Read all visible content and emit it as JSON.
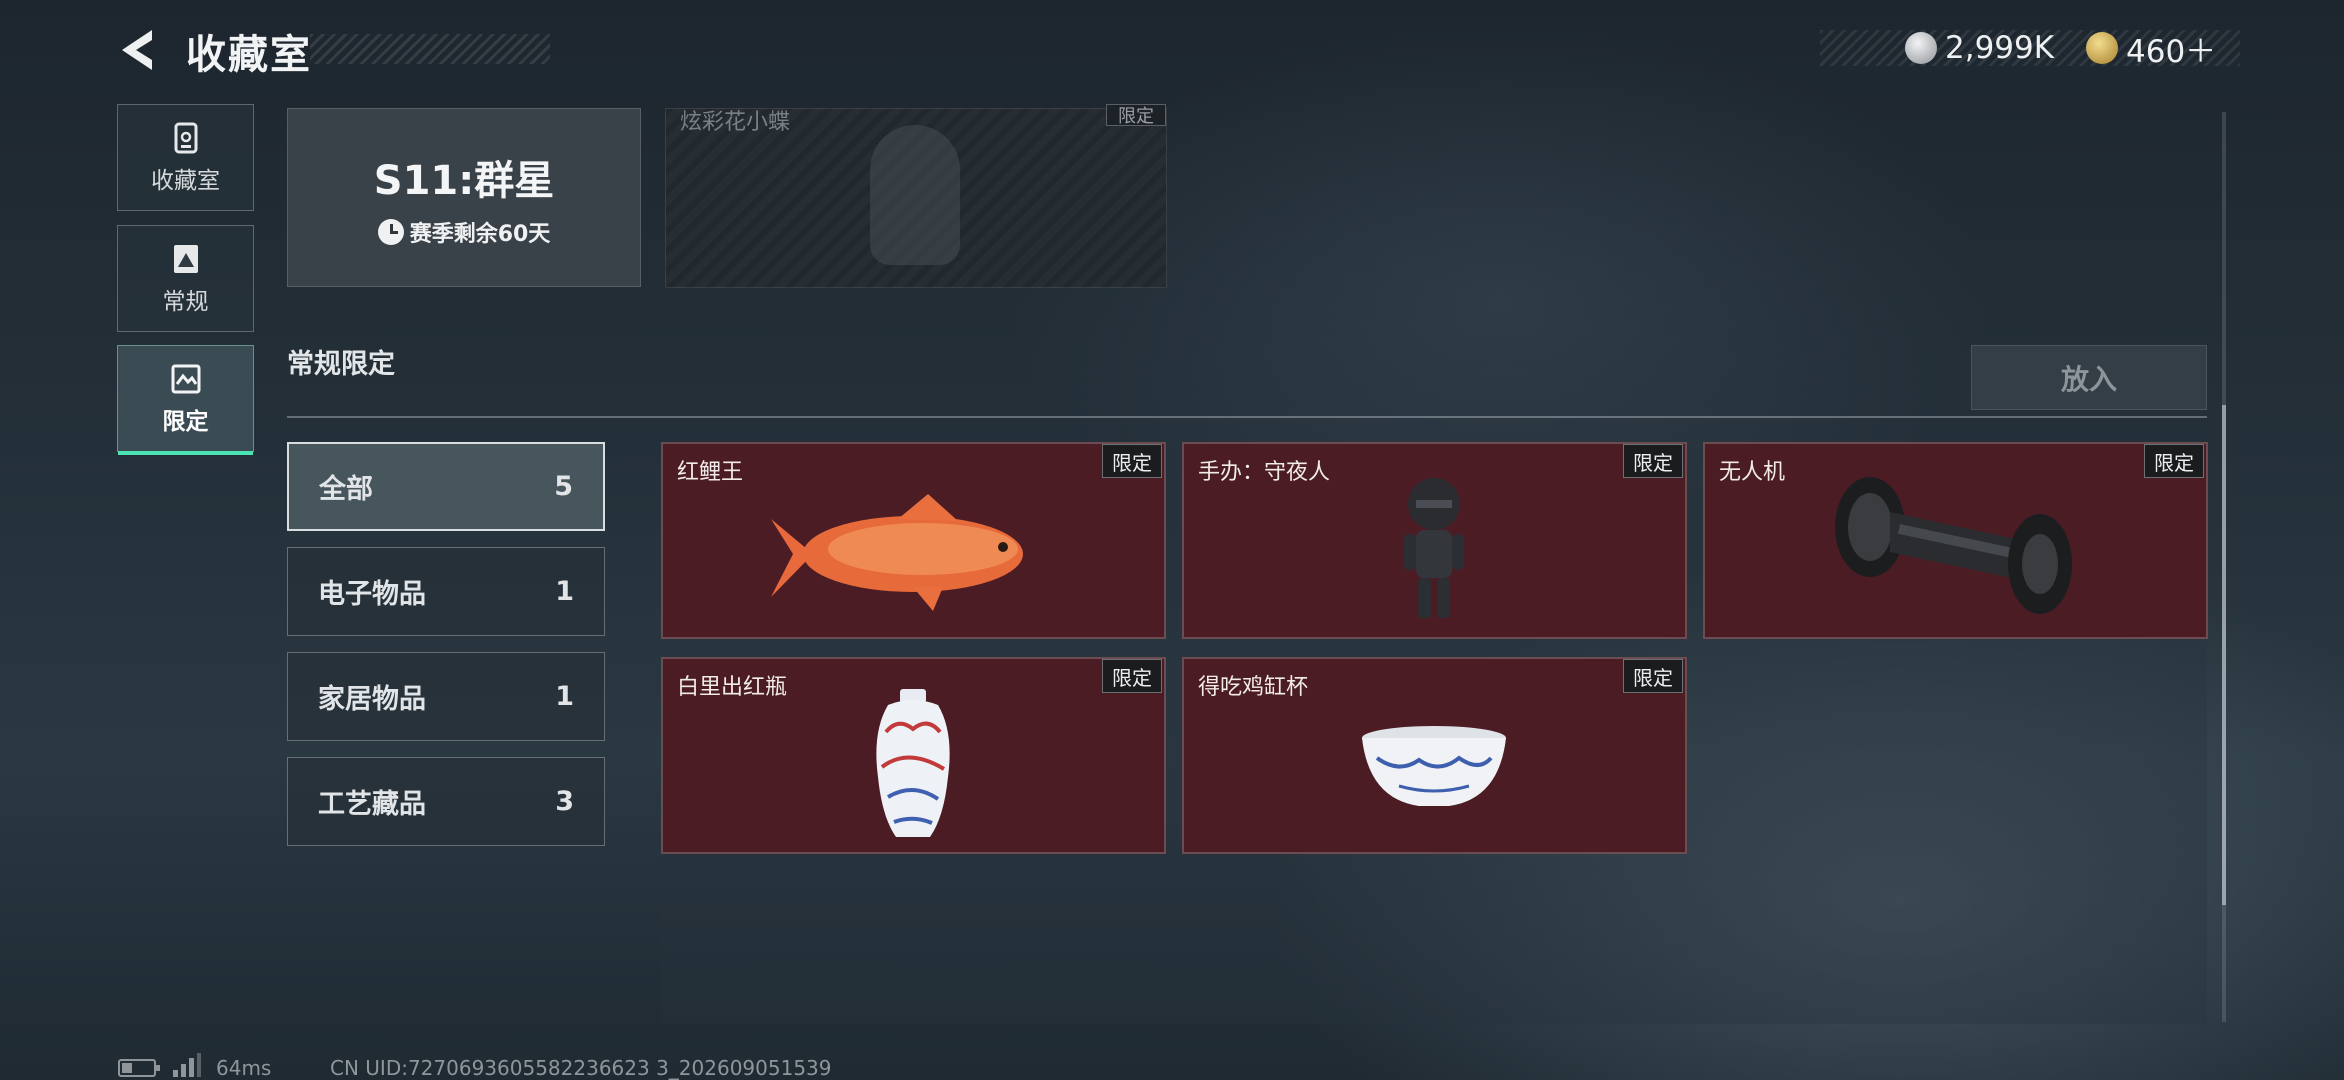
{
  "header": {
    "title": "收藏室",
    "currency_silver": "2,999K",
    "currency_gold": "460＋",
    "silver_color": "#c9ccd0",
    "gold_color": "#c9a24a"
  },
  "sidebar": {
    "items": [
      {
        "label": "收藏室",
        "icon": "vault-icon"
      },
      {
        "label": "常规",
        "icon": "regular-icon"
      },
      {
        "label": "限定",
        "icon": "limited-icon",
        "active": true
      }
    ],
    "active_color": "#4be3b3"
  },
  "season": {
    "name": "S11:群星",
    "remaining": "赛季剩余60天"
  },
  "faded_card": {
    "name": "炫彩花小蝶",
    "tag": "限定"
  },
  "section": {
    "title": "常规限定",
    "put_button": "放入"
  },
  "categories": [
    {
      "label": "全部",
      "count": "5",
      "active": true
    },
    {
      "label": "电子物品",
      "count": "1"
    },
    {
      "label": "家居物品",
      "count": "1"
    },
    {
      "label": "工艺藏品",
      "count": "3"
    }
  ],
  "items": [
    {
      "name": "红鲤王",
      "tag": "限定",
      "art": "red-carp-icon"
    },
    {
      "name": "手办：守夜人",
      "tag": "限定",
      "art": "figurine-icon"
    },
    {
      "name": "无人机",
      "tag": "限定",
      "art": "drone-part-icon"
    },
    {
      "name": "白里出红瓶",
      "tag": "限定",
      "art": "porcelain-vase-icon"
    },
    {
      "name": "得吃鸡缸杯",
      "tag": "限定",
      "art": "porcelain-cup-icon"
    }
  ],
  "card_color": "#4b1c24",
  "status": {
    "ping": "64ms",
    "uid": "CN UID:7270693605582236623 3_202609051539"
  }
}
